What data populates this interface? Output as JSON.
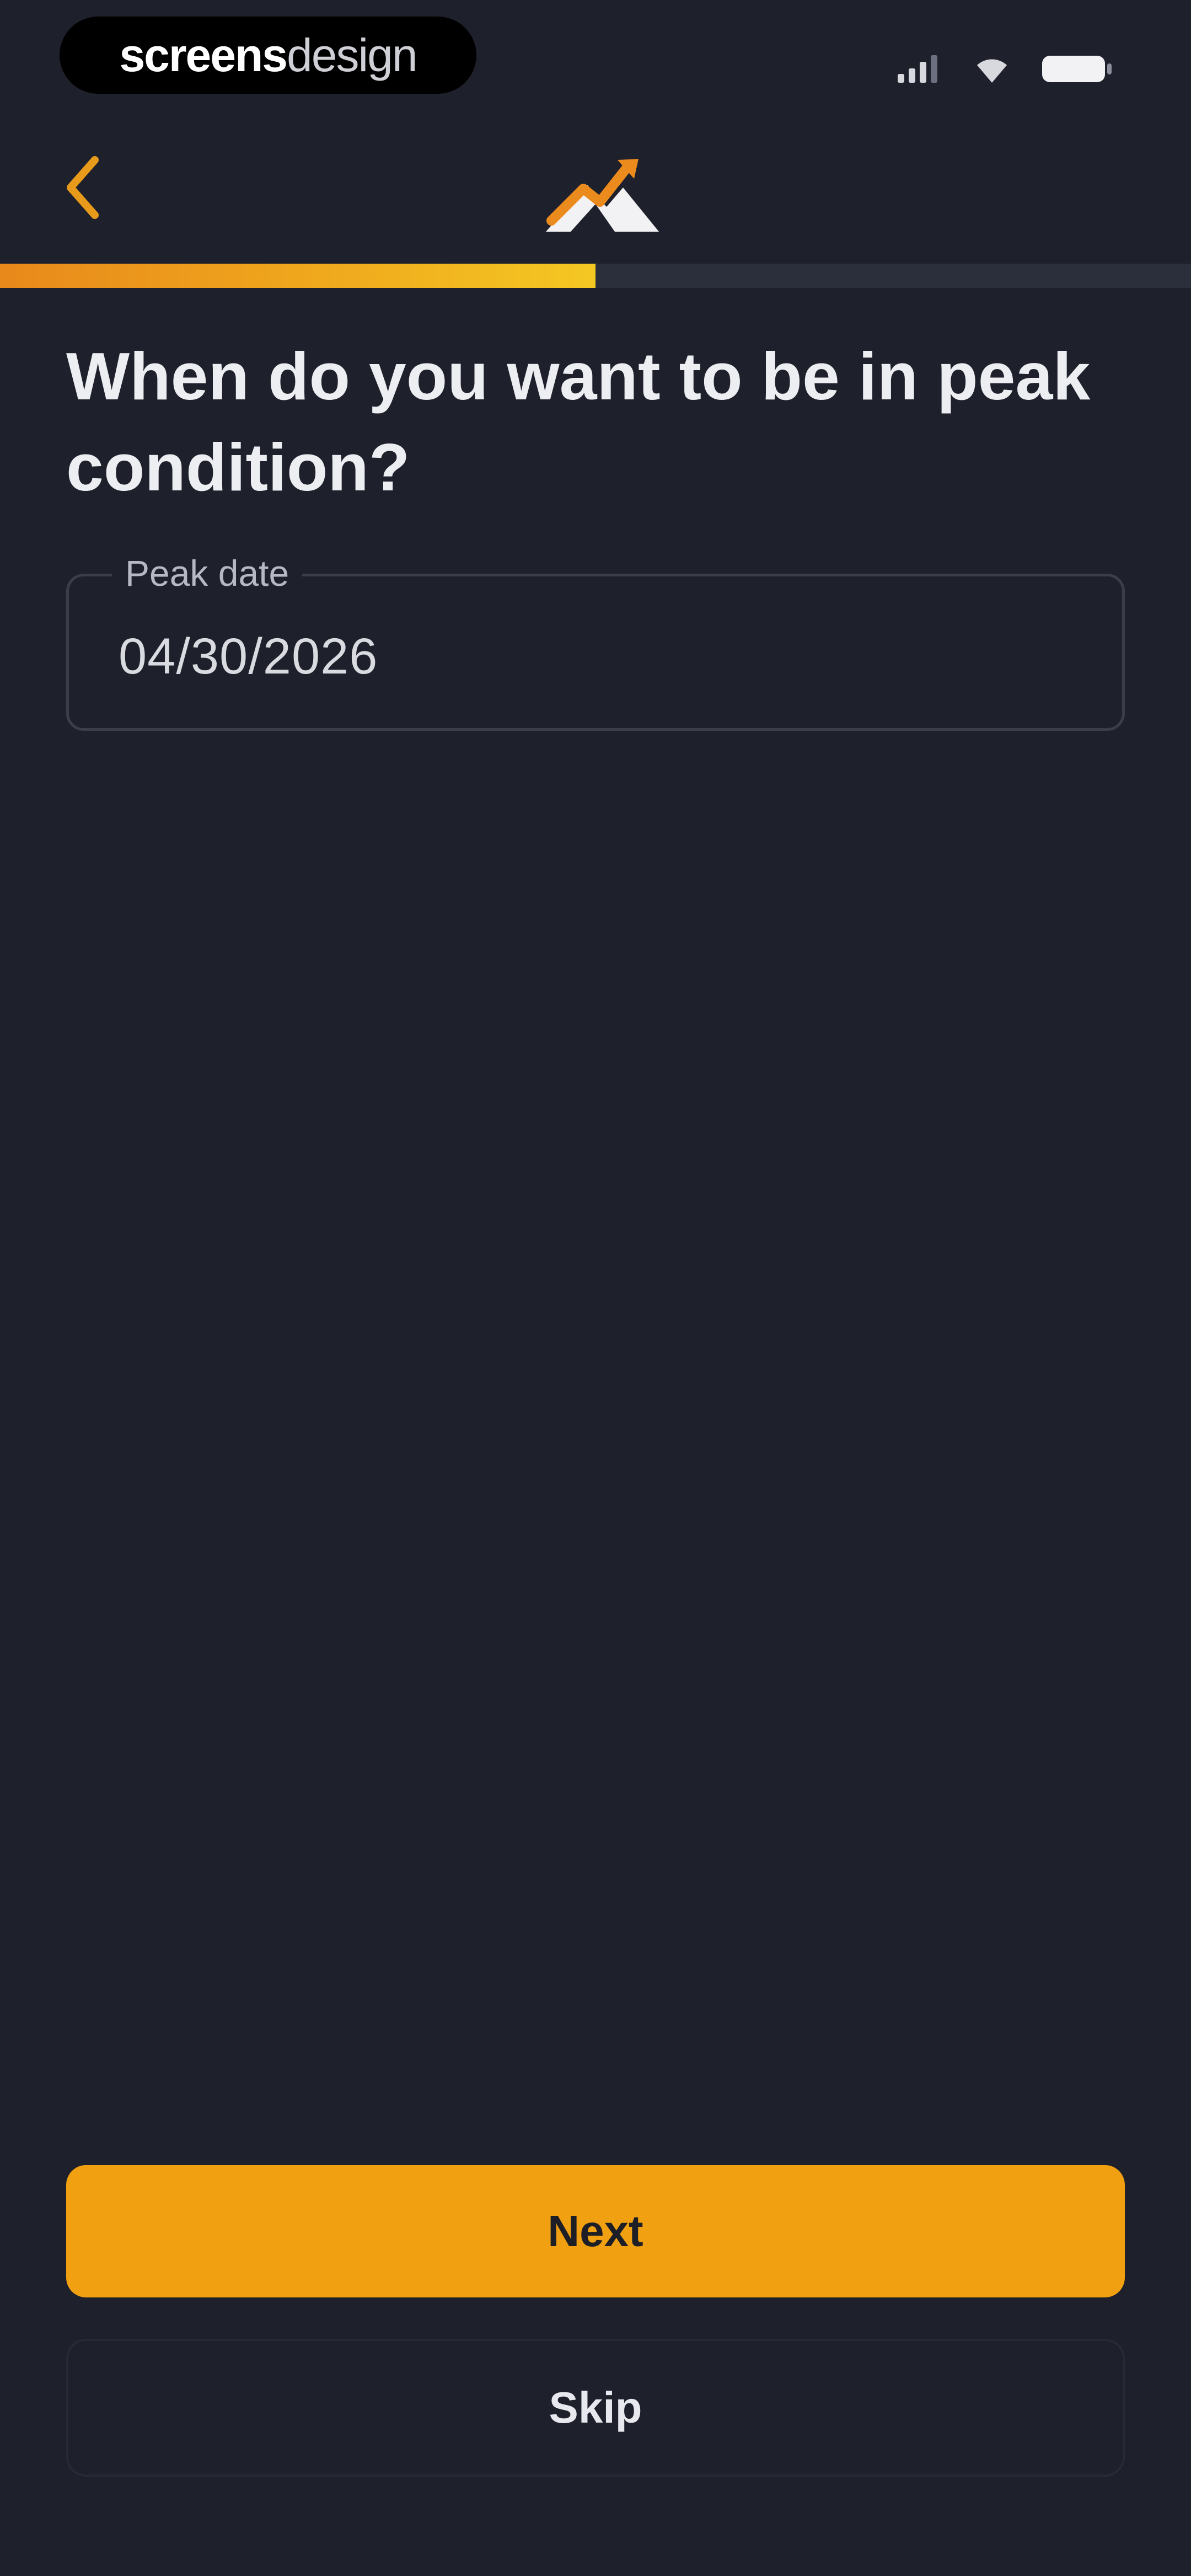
{
  "status_bar": {
    "brand_bold": "screens",
    "brand_light": "design",
    "icons": [
      "signal-icon",
      "wifi-icon",
      "battery-icon"
    ]
  },
  "header": {
    "back_icon": "chevron-left-icon",
    "logo_icon": "mountain-peak-logo-icon"
  },
  "progress": {
    "value": 0.5,
    "fill_color": "#f0a91d",
    "track_color": "#2b2f3b"
  },
  "question": {
    "title": "When do you want to be in peak condition?"
  },
  "date_field": {
    "label": "Peak date",
    "value": "04/30/2026"
  },
  "actions": {
    "next_label": "Next",
    "skip_label": "Skip"
  },
  "colors": {
    "background": "#1e202b",
    "accent": "#f0a010",
    "back_chevron": "#e89a1a"
  }
}
